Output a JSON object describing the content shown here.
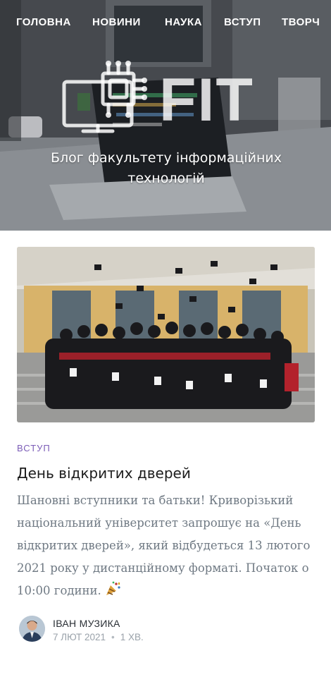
{
  "nav": {
    "items": [
      {
        "label": "ГОЛОВНА"
      },
      {
        "label": "НОВИНИ"
      },
      {
        "label": "НАУКА"
      },
      {
        "label": "ВСТУП"
      },
      {
        "label": "ТВОРЧ"
      }
    ]
  },
  "header": {
    "logo_text": "FIT",
    "tagline": "Блог факультету інформаційних технологій"
  },
  "post": {
    "category": "ВСТУП",
    "title": "День відкритих дверей",
    "excerpt": "Шановні вступники та батьки! Криворізький національний університет запрошує на «День відкритих дверей», який відбудеться 13 лютого 2021 року у дистанційному форматі. Початок о 10:00 години.",
    "excerpt_icon": "party-popper-icon",
    "author": "ІВАН МУЗИКА",
    "date": "7 ЛЮТ 2021",
    "read_time": "1 ХВ.",
    "separator": "•"
  },
  "colors": {
    "category": "#7c5db7",
    "title": "#1c1c1c",
    "excerpt": "#6f7983",
    "meta": "#9aa2aa"
  }
}
